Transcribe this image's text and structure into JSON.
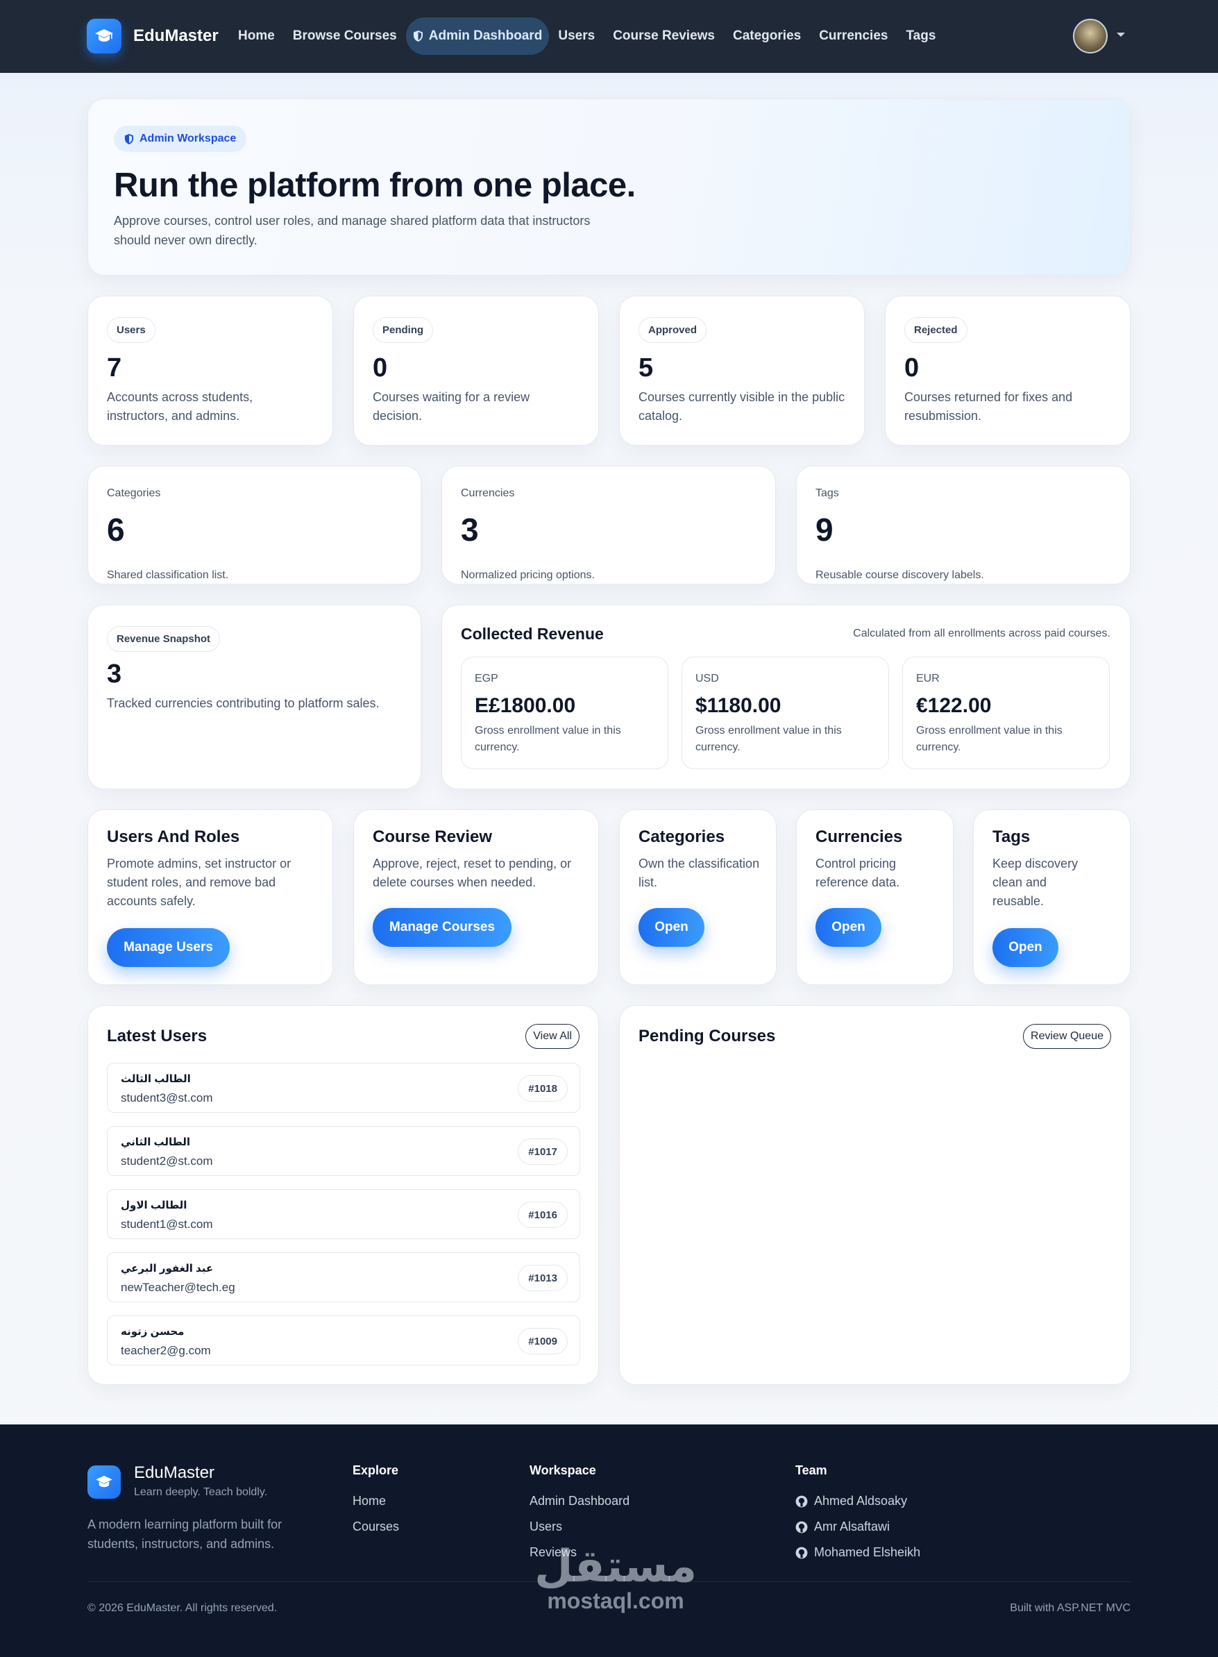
{
  "nav": {
    "brand": "EduMaster",
    "links": [
      "Home",
      "Browse Courses",
      "Admin Dashboard",
      "Users",
      "Course Reviews",
      "Categories",
      "Currencies",
      "Tags"
    ],
    "active_index": 2,
    "logo_icon": "graduation-cap-icon",
    "active_icon": "shield-icon"
  },
  "hero": {
    "badge": "Admin Workspace",
    "title": "Run the platform from one place.",
    "subtitle": "Approve courses, control user roles, and manage shared platform data that instructors should never own directly."
  },
  "stats": [
    {
      "label": "Users",
      "value": "7",
      "desc": "Accounts across students, instructors, and admins."
    },
    {
      "label": "Pending",
      "value": "0",
      "desc": "Courses waiting for a review decision."
    },
    {
      "label": "Approved",
      "value": "5",
      "desc": "Courses currently visible in the public catalog."
    },
    {
      "label": "Rejected",
      "value": "0",
      "desc": "Courses returned for fixes and resubmission."
    }
  ],
  "mini_stats": [
    {
      "label": "Categories",
      "value": "6",
      "desc": "Shared classification list."
    },
    {
      "label": "Currencies",
      "value": "3",
      "desc": "Normalized pricing options."
    },
    {
      "label": "Tags",
      "value": "9",
      "desc": "Reusable course discovery labels."
    }
  ],
  "revenue_snapshot": {
    "label": "Revenue Snapshot",
    "value": "3",
    "desc": "Tracked currencies contributing to platform sales."
  },
  "collected_revenue": {
    "title": "Collected Revenue",
    "note": "Calculated from all enrollments across paid courses.",
    "items": [
      {
        "code": "EGP",
        "amount": "E£1800.00",
        "desc": "Gross enrollment value in this currency."
      },
      {
        "code": "USD",
        "amount": "$1180.00",
        "desc": "Gross enrollment value in this currency."
      },
      {
        "code": "EUR",
        "amount": "€122.00",
        "desc": "Gross enrollment value in this currency."
      }
    ]
  },
  "actions": [
    {
      "title": "Users And Roles",
      "desc": "Promote admins, set instructor or student roles, and remove bad accounts safely.",
      "button": "Manage Users"
    },
    {
      "title": "Course Review",
      "desc": "Approve, reject, reset to pending, or delete courses when needed.",
      "button": "Manage Courses"
    },
    {
      "title": "Categories",
      "desc": "Own the classification list.",
      "button": "Open"
    },
    {
      "title": "Currencies",
      "desc": "Control pricing reference data.",
      "button": "Open"
    },
    {
      "title": "Tags",
      "desc": "Keep discovery clean and reusable.",
      "button": "Open"
    }
  ],
  "latest_users": {
    "title": "Latest Users",
    "button": "View All",
    "rows": [
      {
        "name": "الطالب الثالث",
        "email": "student3@st.com",
        "id": "#1018"
      },
      {
        "name": "الطالب الثاني",
        "email": "student2@st.com",
        "id": "#1017"
      },
      {
        "name": "الطالب الاول",
        "email": "student1@st.com",
        "id": "#1016"
      },
      {
        "name": "عبد الغفور البرعي",
        "email": "newTeacher@tech.eg",
        "id": "#1013"
      },
      {
        "name": "محسن زتونه",
        "email": "teacher2@g.com",
        "id": "#1009"
      }
    ]
  },
  "pending_courses": {
    "title": "Pending Courses",
    "button": "Review Queue"
  },
  "footer": {
    "brand": "EduMaster",
    "tagline": "Learn deeply. Teach boldly.",
    "about": "A modern learning platform built for students, instructors, and admins.",
    "explore_title": "Explore",
    "explore_links": [
      "Home",
      "Courses"
    ],
    "workspace_title": "Workspace",
    "workspace_links": [
      "Admin Dashboard",
      "Users",
      "Reviews"
    ],
    "team_title": "Team",
    "team_links": [
      "Ahmed Aldsoaky",
      "Amr Alsaftawi",
      "Mohamed Elsheikh"
    ],
    "team_icon": "github-icon",
    "copyright": "© 2026 EduMaster. All rights reserved.",
    "built_with": "Built with ASP.NET MVC",
    "watermark_ar": "مستقل",
    "watermark_en": "mostaql.com"
  },
  "colors": {
    "navbar": "#1f2937",
    "accent": "#1d6ff0",
    "footer": "#0f172a"
  }
}
